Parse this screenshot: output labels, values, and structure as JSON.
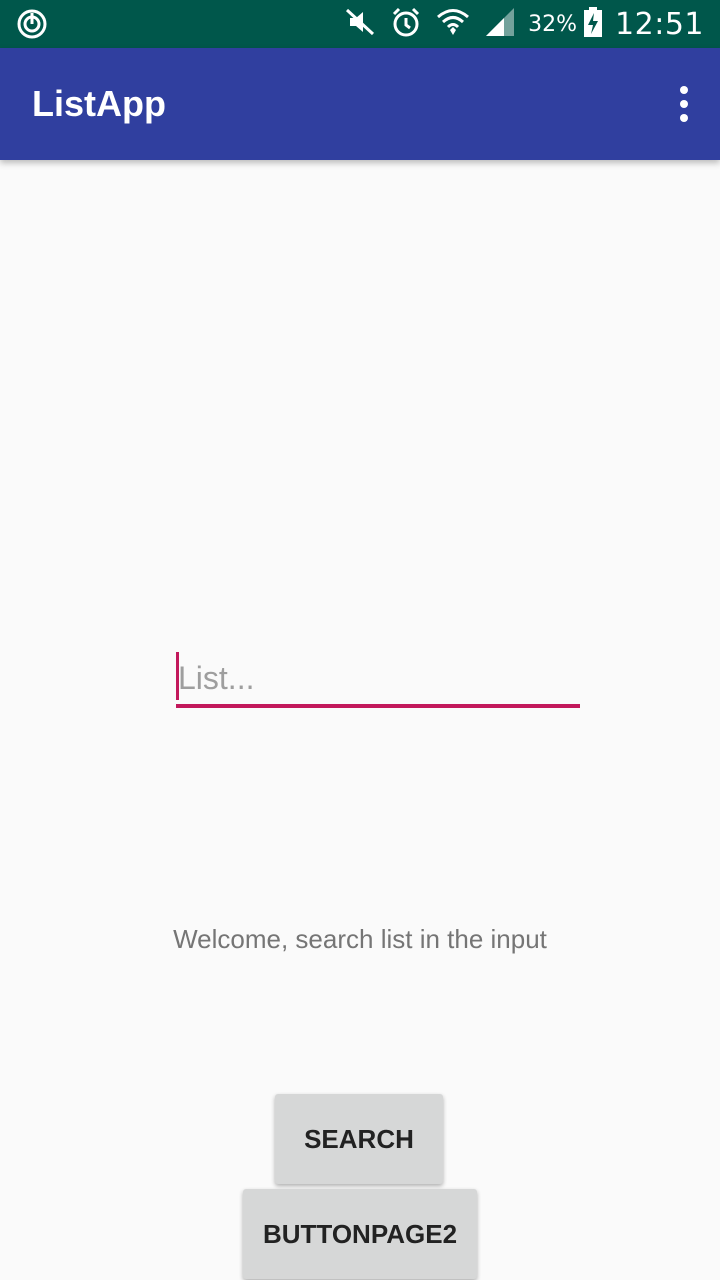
{
  "status_bar": {
    "battery_percent": "32%",
    "time": "12:51",
    "icons": [
      "sync-icon",
      "mute-icon",
      "alarm-icon",
      "wifi-icon",
      "signal-icon",
      "battery-charging-icon"
    ]
  },
  "app_bar": {
    "title": "ListApp",
    "menu_icon": "more-vert-icon"
  },
  "search": {
    "placeholder": "List...",
    "value": ""
  },
  "welcome_text": "Welcome, search list in the input",
  "buttons": {
    "search_label": "SEARCH",
    "page2_label": "BUTTONPAGE2"
  },
  "colors": {
    "status_bar": "#00574b",
    "app_bar": "#303f9f",
    "accent": "#c2185b",
    "button": "#d6d7d7"
  }
}
